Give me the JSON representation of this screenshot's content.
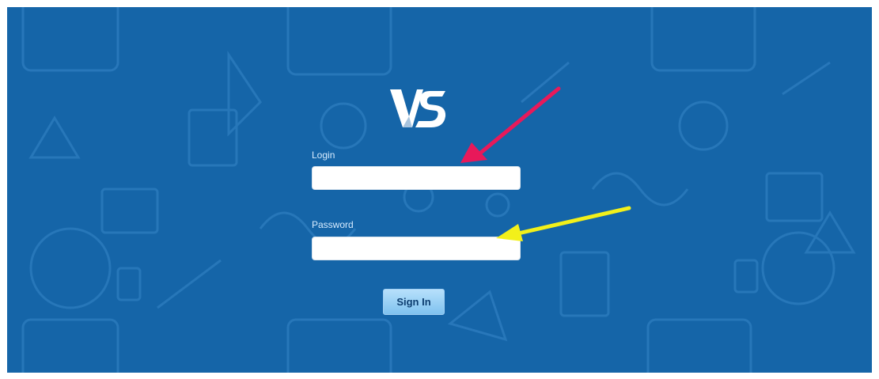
{
  "logo": {
    "text": "VS"
  },
  "form": {
    "login_label": "Login",
    "login_value": "",
    "password_label": "Password",
    "password_value": "",
    "submit_label": "Sign In"
  },
  "annotations": {
    "arrow_login_color": "#e8195a",
    "arrow_password_color": "#f2f01a"
  },
  "colors": {
    "background": "#1565a8",
    "button": "#8ccaf2"
  }
}
